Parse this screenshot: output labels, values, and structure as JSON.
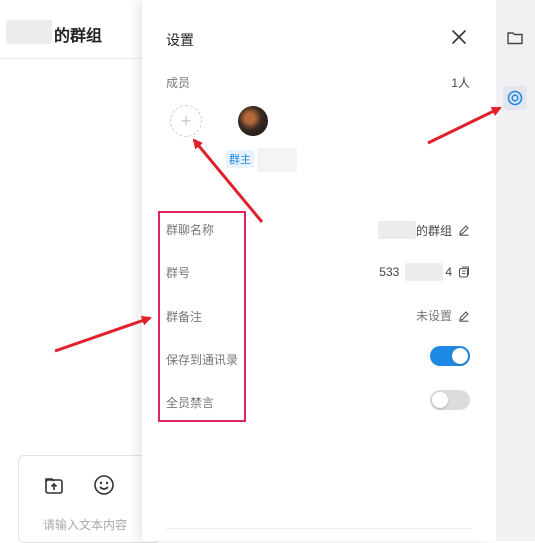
{
  "chat": {
    "title": "的群组",
    "input_placeholder": "请输入文本内容"
  },
  "panel": {
    "title": "设置",
    "members_label": "成员",
    "members_count": "1人",
    "add_icon": "+",
    "owner_tag": "群主",
    "rows": [
      {
        "label": "群聊名称",
        "value": "的群组"
      },
      {
        "label": "群号",
        "value_left": "533",
        "value_right": "4"
      },
      {
        "label": "群备注",
        "value": "未设置"
      },
      {
        "label": "保存到通讯录",
        "toggle_on": true
      },
      {
        "label": "全员禁言",
        "toggle_on": false
      }
    ]
  },
  "colors": {
    "accent": "#1e88e5",
    "highlight": "#e0245e",
    "arrow": "#e0202a",
    "toggle_off": "#dcdcdc"
  }
}
